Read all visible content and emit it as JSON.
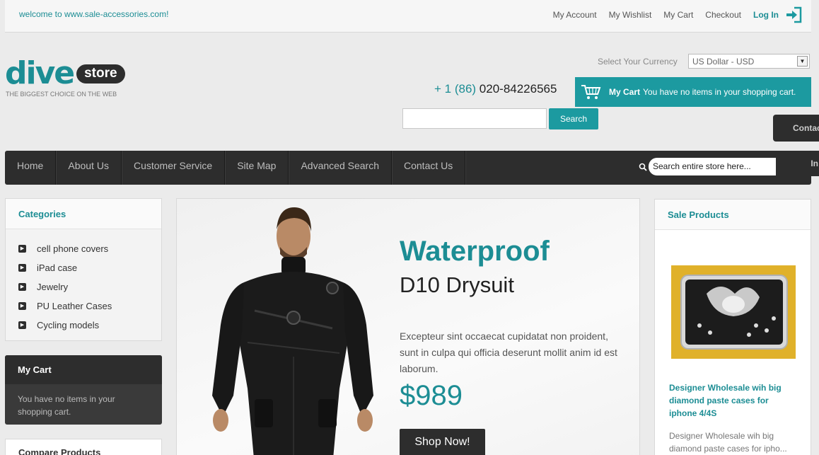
{
  "topbar": {
    "welcome": "welcome to www.sale-accessories.com!",
    "links": [
      "My Account",
      "My Wishlist",
      "My Cart",
      "Checkout"
    ],
    "login": "Log In"
  },
  "logo": {
    "dive": "dive",
    "store": "store",
    "tagline": "THE BIGGEST CHOICE ON THE WEB"
  },
  "currency": {
    "label": "Select Your Currency",
    "selected": "US Dollar - USD"
  },
  "phone": {
    "prefix": "+ 1 (86)",
    "number": "020-84226565"
  },
  "cart_header": {
    "label": "My Cart",
    "message": "You have no items in your shopping cart."
  },
  "header_search": {
    "button": "Search"
  },
  "side_tabs": {
    "contact": "Contact",
    "login": "Log In"
  },
  "nav": {
    "items": [
      "Home",
      "About Us",
      "Customer Service",
      "Site Map",
      "Advanced Search",
      "Contact Us"
    ],
    "search_value": "Search entire store here..."
  },
  "categories": {
    "title": "Categories",
    "items": [
      "cell phone covers",
      "iPad case",
      "Jewelry",
      "PU Leather Cases",
      "Cycling models"
    ]
  },
  "sidebar_cart": {
    "title": "My Cart",
    "message": "You have no items in your shopping cart."
  },
  "compare": {
    "title": "Compare Products"
  },
  "banner": {
    "title": "Waterproof",
    "subtitle": "D10 Drysuit",
    "text": "Excepteur sint occaecat cupidatat non proident, sunt in culpa qui officia deserunt mollit anim id est laborum.",
    "price": "$989",
    "button": "Shop Now!"
  },
  "sale": {
    "title": "Sale Products",
    "product_name": "Designer Wholesale wih big diamond paste cases for iphone 4/4S",
    "product_desc": "Designer Wholesale wih big diamond paste cases for ipho..."
  },
  "colors": {
    "accent": "#1c9aa0",
    "dark": "#2d2d2d"
  }
}
